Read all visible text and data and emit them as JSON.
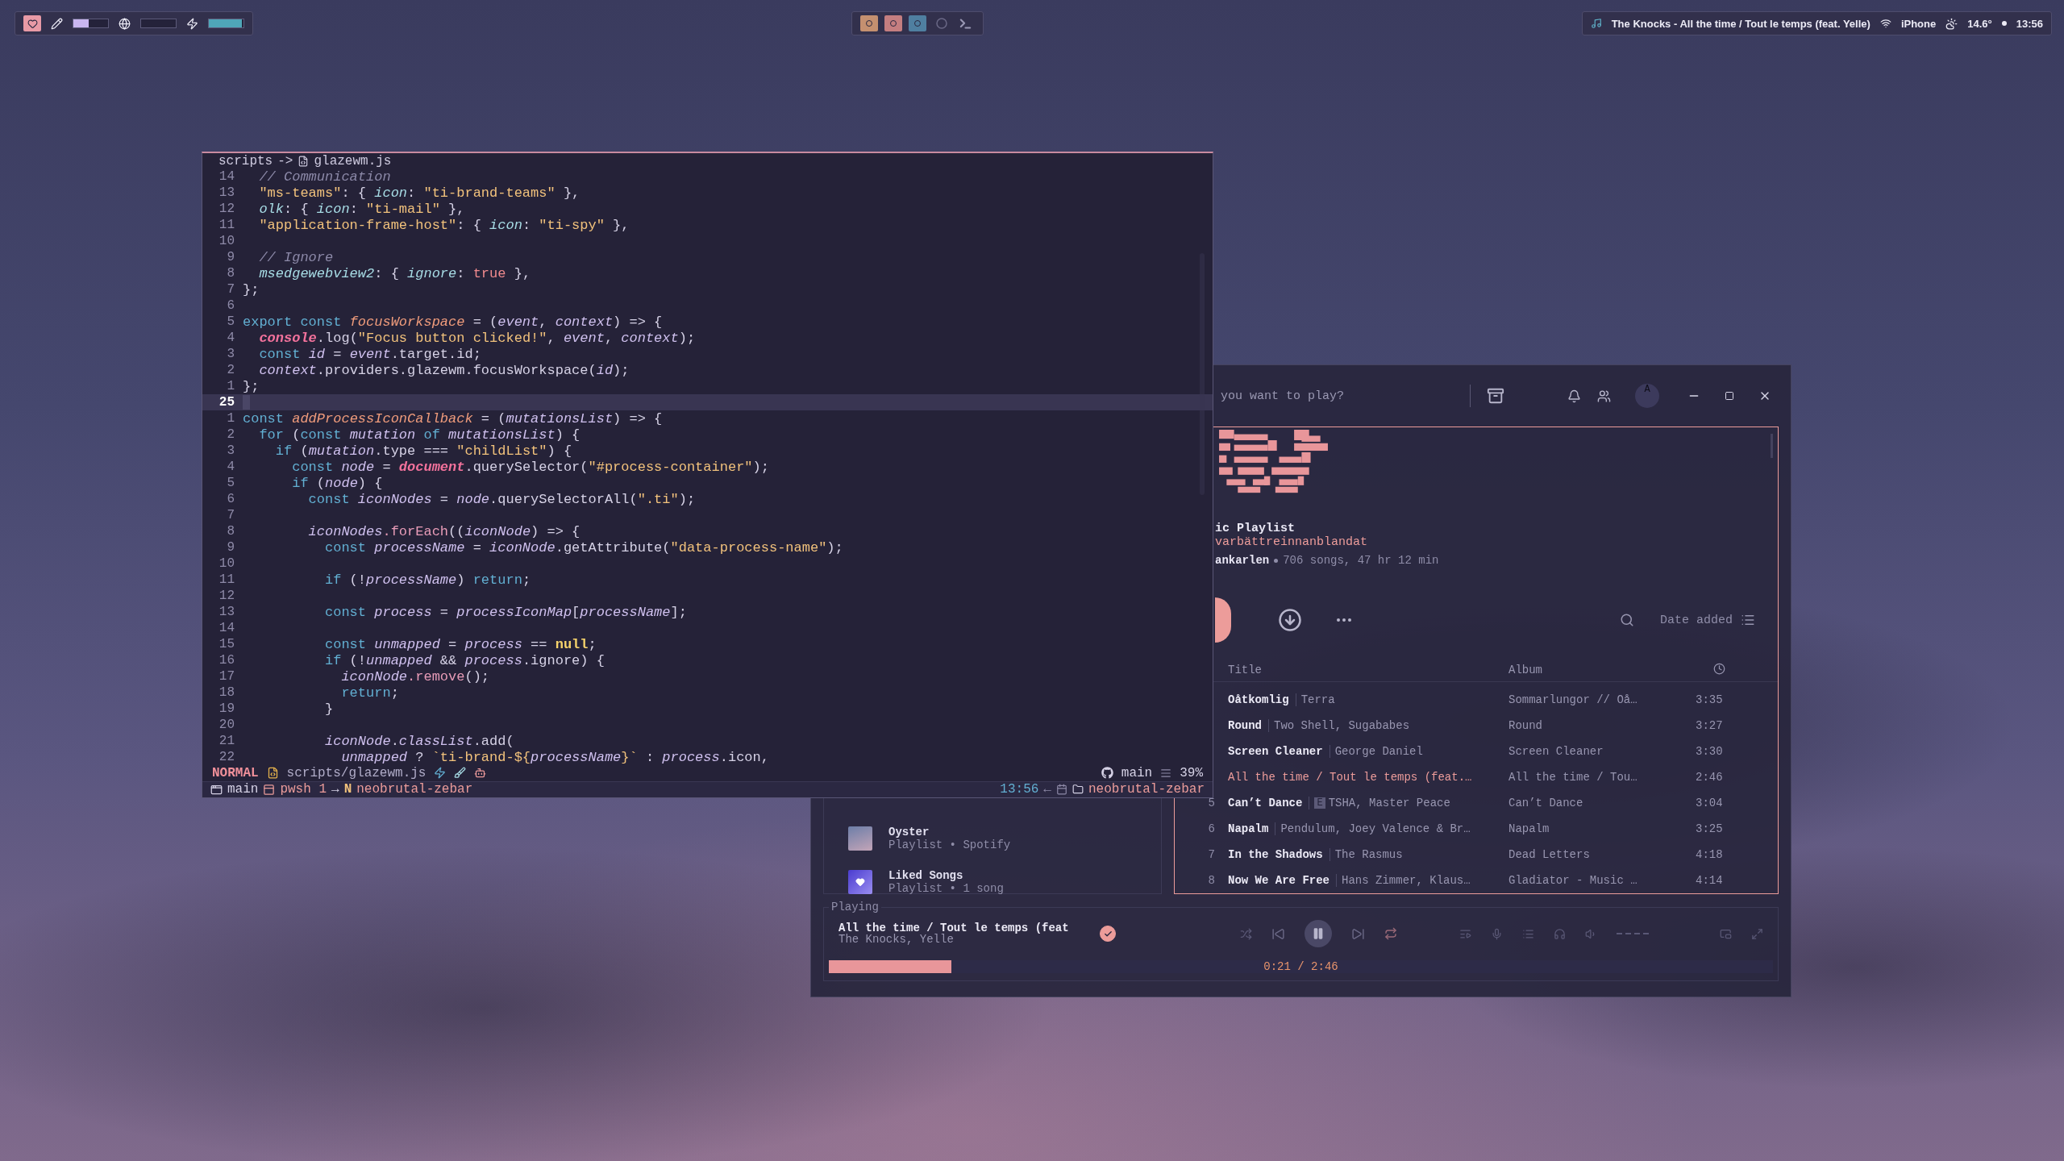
{
  "topbar": {
    "meters": [
      {
        "kind": "pencil",
        "level": 0.45
      },
      {
        "kind": "globe"
      },
      {
        "kind": "bolt",
        "level": 0.95
      }
    ],
    "workspaces": [
      {
        "kind": "dot",
        "color": "#c49070"
      },
      {
        "kind": "dot",
        "color": "#c47e80"
      },
      {
        "kind": "dot",
        "color": "#4f7fa0"
      },
      {
        "kind": "ring",
        "color": "#6a6886"
      },
      {
        "kind": "terminal",
        "color": "#9a98b4"
      }
    ],
    "now_playing": "The Knocks - All the time / Tout le temps (feat. Yelle)",
    "wifi": "iPhone",
    "weather": "14.6°",
    "clock": "13:56"
  },
  "editor": {
    "folder": "scripts",
    "arrow": "->",
    "file": "glazewm.js",
    "lines": [
      {
        "number": "14",
        "current": false,
        "tokens": [
          {
            "kind": "comment",
            "text": "  // Communication"
          }
        ]
      },
      {
        "number": "13",
        "current": false,
        "tokens": [
          {
            "kind": "string",
            "text": "  \"ms-teams\""
          },
          {
            "kind": "plain",
            "text": ": { "
          },
          {
            "kind": "prop",
            "text": "icon"
          },
          {
            "kind": "plain",
            "text": ": "
          },
          {
            "kind": "string",
            "text": "\"ti-brand-teams\""
          },
          {
            "kind": "plain",
            "text": " },"
          }
        ]
      },
      {
        "number": "12",
        "current": false,
        "tokens": [
          {
            "kind": "prop",
            "text": "  olk"
          },
          {
            "kind": "plain",
            "text": ": { "
          },
          {
            "kind": "prop",
            "text": "icon"
          },
          {
            "kind": "plain",
            "text": ": "
          },
          {
            "kind": "string",
            "text": "\"ti-mail\""
          },
          {
            "kind": "plain",
            "text": " },"
          }
        ]
      },
      {
        "number": "11",
        "current": false,
        "tokens": [
          {
            "kind": "string",
            "text": "  \"application-frame-host\""
          },
          {
            "kind": "plain",
            "text": ": { "
          },
          {
            "kind": "prop",
            "text": "icon"
          },
          {
            "kind": "plain",
            "text": ": "
          },
          {
            "kind": "string",
            "text": "\"ti-spy\""
          },
          {
            "kind": "plain",
            "text": " },"
          }
        ]
      },
      {
        "number": "10",
        "current": false
      },
      {
        "number": "9",
        "current": false,
        "tokens": [
          {
            "kind": "comment",
            "text": "  // Ignore"
          }
        ]
      },
      {
        "number": "8",
        "current": false,
        "tokens": [
          {
            "kind": "prop",
            "text": "  msedgewebview2"
          },
          {
            "kind": "plain",
            "text": ": { "
          },
          {
            "kind": "prop",
            "text": "ignore"
          },
          {
            "kind": "plain",
            "text": ": "
          },
          {
            "kind": "literal",
            "text": "true"
          },
          {
            "kind": "plain",
            "text": " },"
          }
        ]
      },
      {
        "number": "7",
        "current": false,
        "tokens": [
          {
            "kind": "plain",
            "text": "};"
          }
        ]
      },
      {
        "number": "6",
        "current": false
      },
      {
        "number": "5",
        "current": false,
        "tokens": [
          {
            "kind": "keyword",
            "text": "export const "
          },
          {
            "kind": "fn",
            "text": "focusWorkspace"
          },
          {
            "kind": "plain",
            "text": " = ("
          },
          {
            "kind": "var",
            "text": "event"
          },
          {
            "kind": "plain",
            "text": ", "
          },
          {
            "kind": "var",
            "text": "context"
          },
          {
            "kind": "plain",
            "text": ") => {"
          }
        ]
      },
      {
        "number": "4",
        "current": false,
        "tokens": [
          {
            "kind": "global",
            "text": "  console"
          },
          {
            "kind": "plain",
            "text": ".log("
          },
          {
            "kind": "string",
            "text": "\"Focus button clicked!\""
          },
          {
            "kind": "plain",
            "text": ", "
          },
          {
            "kind": "var",
            "text": "event"
          },
          {
            "kind": "plain",
            "text": ", "
          },
          {
            "kind": "var",
            "text": "context"
          },
          {
            "kind": "plain",
            "text": ");"
          }
        ]
      },
      {
        "number": "3",
        "current": false,
        "tokens": [
          {
            "kind": "keyword",
            "text": "  const "
          },
          {
            "kind": "var",
            "text": "id"
          },
          {
            "kind": "plain",
            "text": " = "
          },
          {
            "kind": "var",
            "text": "event"
          },
          {
            "kind": "plain",
            "text": ".target.id;"
          }
        ]
      },
      {
        "number": "2",
        "current": false,
        "tokens": [
          {
            "kind": "var",
            "text": "  context"
          },
          {
            "kind": "plain",
            "text": ".providers.glazewm.focusWorkspace("
          },
          {
            "kind": "var",
            "text": "id"
          },
          {
            "kind": "plain",
            "text": ");"
          }
        ]
      },
      {
        "number": "1",
        "current": false,
        "tokens": [
          {
            "kind": "plain",
            "text": "};"
          }
        ]
      },
      {
        "number": "25",
        "current": true
      },
      {
        "number": "1",
        "current": false,
        "tokens": [
          {
            "kind": "keyword",
            "text": "const "
          },
          {
            "kind": "fn",
            "text": "addProcessIconCallback"
          },
          {
            "kind": "plain",
            "text": " = ("
          },
          {
            "kind": "var",
            "text": "mutationsList"
          },
          {
            "kind": "plain",
            "text": ") => {"
          }
        ]
      },
      {
        "number": "2",
        "current": false,
        "tokens": [
          {
            "kind": "keyword",
            "text": "  for"
          },
          {
            "kind": "plain",
            "text": " ("
          },
          {
            "kind": "keyword",
            "text": "const "
          },
          {
            "kind": "var",
            "text": "mutation"
          },
          {
            "kind": "keyword",
            "text": " of "
          },
          {
            "kind": "var",
            "text": "mutationsList"
          },
          {
            "kind": "plain",
            "text": ") {"
          }
        ]
      },
      {
        "number": "3",
        "current": false,
        "tokens": [
          {
            "kind": "keyword",
            "text": "    if"
          },
          {
            "kind": "plain",
            "text": " ("
          },
          {
            "kind": "var",
            "text": "mutation"
          },
          {
            "kind": "plain",
            "text": ".type === "
          },
          {
            "kind": "string",
            "text": "\"childList\""
          },
          {
            "kind": "plain",
            "text": ") {"
          }
        ]
      },
      {
        "number": "4",
        "current": false,
        "tokens": [
          {
            "kind": "keyword",
            "text": "      const "
          },
          {
            "kind": "var",
            "text": "node"
          },
          {
            "kind": "plain",
            "text": " = "
          },
          {
            "kind": "global",
            "text": "document"
          },
          {
            "kind": "plain",
            "text": ".querySelector("
          },
          {
            "kind": "string",
            "text": "\"#process-container\""
          },
          {
            "kind": "plain",
            "text": ");"
          }
        ]
      },
      {
        "number": "5",
        "current": false,
        "tokens": [
          {
            "kind": "keyword",
            "text": "      if"
          },
          {
            "kind": "plain",
            "text": " ("
          },
          {
            "kind": "var",
            "text": "node"
          },
          {
            "kind": "plain",
            "text": ") {"
          }
        ]
      },
      {
        "number": "6",
        "current": false,
        "tokens": [
          {
            "kind": "keyword",
            "text": "        const "
          },
          {
            "kind": "var",
            "text": "iconNodes"
          },
          {
            "kind": "plain",
            "text": " = "
          },
          {
            "kind": "var",
            "text": "node"
          },
          {
            "kind": "plain",
            "text": ".querySelectorAll("
          },
          {
            "kind": "string",
            "text": "\".ti\""
          },
          {
            "kind": "plain",
            "text": ");"
          }
        ]
      },
      {
        "number": "7",
        "current": false
      },
      {
        "number": "8",
        "current": false,
        "tokens": [
          {
            "kind": "var",
            "text": "        iconNodes"
          },
          {
            "kind": "method",
            "text": ".forEach"
          },
          {
            "kind": "plain",
            "text": "(("
          },
          {
            "kind": "var",
            "text": "iconNode"
          },
          {
            "kind": "plain",
            "text": ") => {"
          }
        ]
      },
      {
        "number": "9",
        "current": false,
        "tokens": [
          {
            "kind": "keyword",
            "text": "          const "
          },
          {
            "kind": "var",
            "text": "processName"
          },
          {
            "kind": "plain",
            "text": " = "
          },
          {
            "kind": "var",
            "text": "iconNode"
          },
          {
            "kind": "plain",
            "text": ".getAttribute("
          },
          {
            "kind": "string",
            "text": "\"data-process-name\""
          },
          {
            "kind": "plain",
            "text": ");"
          }
        ]
      },
      {
        "number": "10",
        "current": false
      },
      {
        "number": "11",
        "current": false,
        "tokens": [
          {
            "kind": "keyword",
            "text": "          if"
          },
          {
            "kind": "plain",
            "text": " (!"
          },
          {
            "kind": "var",
            "text": "processName"
          },
          {
            "kind": "plain",
            "text": ") "
          },
          {
            "kind": "keyword",
            "text": "return"
          },
          {
            "kind": "plain",
            "text": ";"
          }
        ]
      },
      {
        "number": "12",
        "current": false
      },
      {
        "number": "13",
        "current": false,
        "tokens": [
          {
            "kind": "keyword",
            "text": "          const "
          },
          {
            "kind": "var",
            "text": "process"
          },
          {
            "kind": "plain",
            "text": " = "
          },
          {
            "kind": "var",
            "text": "processIconMap"
          },
          {
            "kind": "plain",
            "text": "["
          },
          {
            "kind": "var",
            "text": "processName"
          },
          {
            "kind": "plain",
            "text": "];"
          }
        ]
      },
      {
        "number": "14",
        "current": false
      },
      {
        "number": "15",
        "current": false,
        "tokens": [
          {
            "kind": "keyword",
            "text": "          const "
          },
          {
            "kind": "var",
            "text": "unmapped"
          },
          {
            "kind": "plain",
            "text": " = "
          },
          {
            "kind": "var",
            "text": "process"
          },
          {
            "kind": "plain",
            "text": " == "
          },
          {
            "kind": "constant",
            "text": "null"
          },
          {
            "kind": "plain",
            "text": ";"
          }
        ]
      },
      {
        "number": "16",
        "current": false,
        "tokens": [
          {
            "kind": "keyword",
            "text": "          if"
          },
          {
            "kind": "plain",
            "text": " (!"
          },
          {
            "kind": "var",
            "text": "unmapped"
          },
          {
            "kind": "plain",
            "text": " && "
          },
          {
            "kind": "var",
            "text": "process"
          },
          {
            "kind": "plain",
            "text": ".ignore) {"
          }
        ]
      },
      {
        "number": "17",
        "current": false,
        "tokens": [
          {
            "kind": "var",
            "text": "            iconNode"
          },
          {
            "kind": "method",
            "text": ".remove"
          },
          {
            "kind": "plain",
            "text": "();"
          }
        ]
      },
      {
        "number": "18",
        "current": false,
        "tokens": [
          {
            "kind": "keyword",
            "text": "            return"
          },
          {
            "kind": "plain",
            "text": ";"
          }
        ]
      },
      {
        "number": "19",
        "current": false,
        "tokens": [
          {
            "kind": "plain",
            "text": "          }"
          }
        ]
      },
      {
        "number": "20",
        "current": false
      },
      {
        "number": "21",
        "current": false,
        "tokens": [
          {
            "kind": "var",
            "text": "          iconNode"
          },
          {
            "kind": "plain",
            "text": "."
          },
          {
            "kind": "var",
            "text": "classList"
          },
          {
            "kind": "plain",
            "text": ".add("
          }
        ]
      },
      {
        "number": "22",
        "current": false,
        "tokens": [
          {
            "kind": "var",
            "text": "            unmapped"
          },
          {
            "kind": "plain",
            "text": " ? "
          },
          {
            "kind": "string",
            "text": "`ti-brand-${"
          },
          {
            "kind": "var",
            "text": "processName"
          },
          {
            "kind": "string",
            "text": "}`"
          },
          {
            "kind": "plain",
            "text": " : "
          },
          {
            "kind": "var",
            "text": "process"
          },
          {
            "kind": "plain",
            "text": ".icon,"
          }
        ]
      }
    ],
    "status": {
      "mode": "NORMAL",
      "file": "scripts/glazewm.js",
      "branch": "main",
      "percent": "39%"
    },
    "tmux": {
      "session": "main",
      "window": "pwsh 1",
      "arrow": "→",
      "badge": "N",
      "path": "neobrutal-zebar",
      "time": "13:56",
      "back": "←",
      "dir": "neobrutal-zebar"
    }
  },
  "spotify": {
    "search_placeholder": "you want to play?",
    "avatar": "A",
    "playlist": {
      "type": "ic Playlist",
      "name": "varbättreinnanblandat",
      "owner": "ankarlen",
      "stats": "706 songs, 47 hr 12 min",
      "sort": "Date added",
      "columns": [
        "Title",
        "Album"
      ],
      "tracks": [
        {
          "title": "Oåtkomlig",
          "artist": "Terra",
          "album": "Sommarlungor // Oå…",
          "duration": "3:35",
          "playing": false
        },
        {
          "title": "Round",
          "artist": "Two Shell, Sugababes",
          "album": "Round",
          "duration": "3:27",
          "playing": false
        },
        {
          "title": "Screen Cleaner",
          "artist": "George Daniel",
          "album": "Screen Cleaner",
          "duration": "3:30",
          "playing": false
        },
        {
          "title": "All the time / Tout le temps (feat.…",
          "album": "All the time / Tou…",
          "duration": "2:46",
          "playing": true
        },
        {
          "number": "5",
          "title": "Can’t Dance",
          "badge": "E",
          "artist": "TSHA, Master Peace",
          "album": "Can’t Dance",
          "duration": "3:04",
          "playing": false
        },
        {
          "number": "6",
          "title": "Napalm",
          "artist": "Pendulum, Joey Valence & Br…",
          "album": "Napalm",
          "duration": "3:25",
          "playing": false
        },
        {
          "number": "7",
          "title": "In the Shadows",
          "artist": "The Rasmus",
          "album": "Dead Letters",
          "duration": "4:18",
          "playing": false
        },
        {
          "number": "8",
          "title": "Now We Are Free",
          "artist": "Hans Zimmer, Klaus…",
          "album": "Gladiator - Music …",
          "duration": "4:14",
          "playing": false
        }
      ]
    },
    "library": [
      {
        "kind": "cover",
        "name": "Oyster",
        "meta": "Playlist • Spotify"
      },
      {
        "kind": "liked",
        "name": "Liked Songs",
        "meta": "Playlist • 1 song"
      }
    ],
    "player": {
      "label": "Playing",
      "title": "All the time / Tout le temps (feat",
      "artists": "The Knocks, Yelle",
      "liked": true,
      "level": 0.13,
      "time": "0:21 / 2:46"
    }
  }
}
